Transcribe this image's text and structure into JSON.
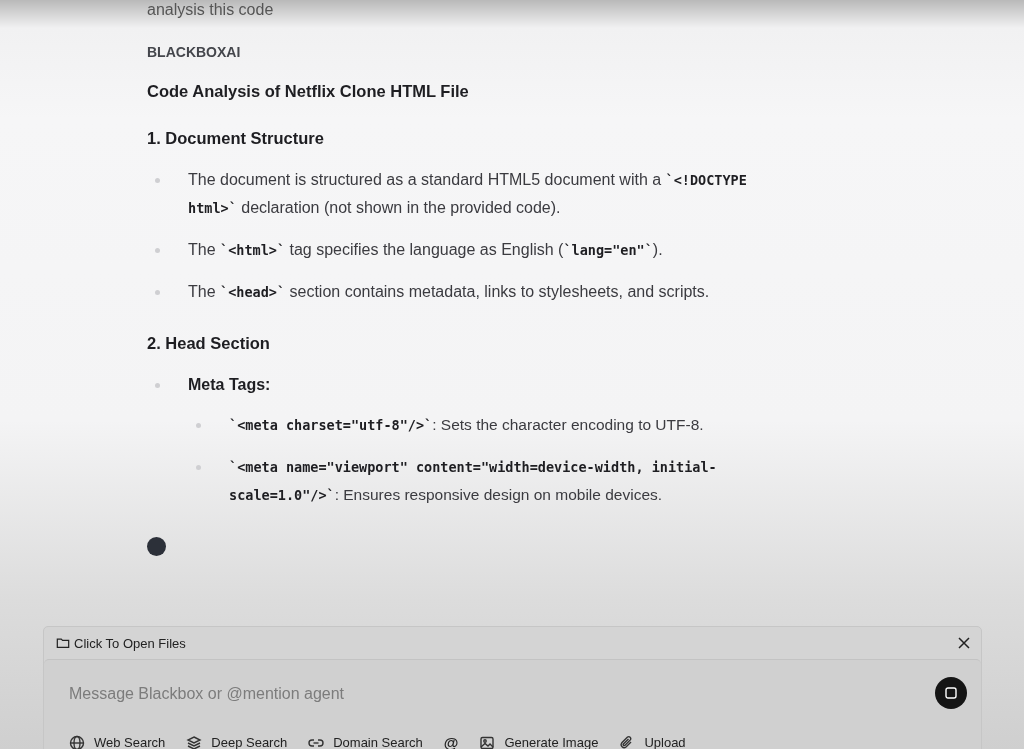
{
  "user_message": "analysis this code",
  "sender": "BLACKBOXAI",
  "title": "Code Analysis of Netflix Clone HTML File",
  "sections": [
    {
      "heading": "1. Document Structure",
      "items": [
        {
          "parts": [
            {
              "kind": "text",
              "text": "The document is structured as a standard HTML5 document with a "
            },
            {
              "kind": "code",
              "text": "`<!DOCTYPE html>`"
            },
            {
              "kind": "text",
              "text": " declaration (not shown in the provided code)."
            }
          ]
        },
        {
          "parts": [
            {
              "kind": "text",
              "text": "The "
            },
            {
              "kind": "code",
              "text": "`<html>`"
            },
            {
              "kind": "text",
              "text": " tag specifies the language as English ("
            },
            {
              "kind": "code",
              "text": "`lang=\"en\"`"
            },
            {
              "kind": "text",
              "text": ")."
            }
          ]
        },
        {
          "parts": [
            {
              "kind": "text",
              "text": "The "
            },
            {
              "kind": "code",
              "text": "`<head>`"
            },
            {
              "kind": "text",
              "text": " section contains metadata, links to stylesheets, and scripts."
            }
          ]
        }
      ]
    },
    {
      "heading": "2. Head Section",
      "items": [
        {
          "parts": [
            {
              "kind": "strong",
              "text": "Meta Tags:"
            }
          ],
          "children": [
            {
              "parts": [
                {
                  "kind": "code",
                  "text": "`<meta charset=\"utf-8\"/>`"
                },
                {
                  "kind": "text",
                  "text": ": Sets the character encoding to UTF-8."
                }
              ]
            },
            {
              "parts": [
                {
                  "kind": "code",
                  "text": "`<meta name=\"viewport\" content=\"width=device-width, initial-scale=1.0\"/>`"
                },
                {
                  "kind": "text",
                  "text": ": Ensures responsive design on mobile devices."
                }
              ]
            }
          ]
        }
      ]
    }
  ],
  "composer": {
    "files_label": "Click To Open Files",
    "placeholder": "Message Blackbox or @mention agent",
    "tools": [
      {
        "kind": "globe",
        "label": "Web Search"
      },
      {
        "kind": "layers",
        "label": "Deep Search"
      },
      {
        "kind": "link",
        "label": "Domain Search"
      },
      {
        "kind": "at",
        "label": "@"
      },
      {
        "kind": "image",
        "label": "Generate Image"
      },
      {
        "kind": "clip",
        "label": "Upload"
      }
    ]
  }
}
